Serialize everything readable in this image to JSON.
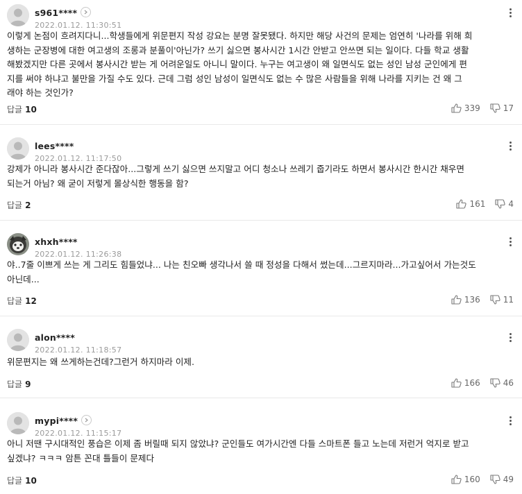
{
  "comments": [
    {
      "username": "s961****",
      "date": "2022.01.12. 11:30:51",
      "lines": [
        "이렇게 논점이 흐려지다니...학생들에게 위문편지 작성 강요는 분명 잘못됐다. 하지만 해당 사건의 문제는 엄연히 '나라를 위해 희",
        "생하는 군장병에 대한 여고생의 조롱과 분풀이'아닌가? 쓰기 싫으면 봉사시간 1시간 안받고 안쓰면 되는 일이다. 다들 학교 생활",
        "해봤겠지만 다른 곳에서 봉사시간 받는 게 어려운일도 아니니 말이다. 누구는 여고생이 왜 일면식도 없는 성인 남성 군인에게 편",
        "지를 써야 하냐고 불만을 가질 수도 있다. 근데 그럼 성인 남성이 일면식도 없는 수 많은 사람들을 위해 나라를 지키는 건 왜 그",
        "래야 하는 것인가?"
      ],
      "reply_label": "답글",
      "reply_count": "10",
      "likes": "339",
      "dislikes": "17"
    },
    {
      "username": "lees****",
      "date": "2022.01.12. 11:17:50",
      "lines": [
        "강제가 아니라 봉사시간 준다잖아...그렇게 쓰기 싫으면 쓰지말고 어디 청소나 쓰레기 줍기라도 하면서 봉사시간 한시간 채우면",
        "되는거 아님? 왜 굳이 저렇게 몰상식한 행동을 함?"
      ],
      "reply_label": "답글",
      "reply_count": "2",
      "likes": "161",
      "dislikes": "4"
    },
    {
      "username": "xhxh****",
      "date": "2022.01.12. 11:26:38",
      "lines": [
        "야..7줄 이쁘게 쓰는 게 그리도 힘들었냐... 나는 친오빠 생각나서 쓸 때 정성을 다해서 썼는데...그르지마라...가고싶어서 가는것도",
        "아닌데..."
      ],
      "reply_label": "답글",
      "reply_count": "12",
      "likes": "136",
      "dislikes": "11"
    },
    {
      "username": "alon****",
      "date": "2022.01.12. 11:18:57",
      "lines": [
        "위문편지는 왜 쓰게하는건데?그런거 하지마라 이제."
      ],
      "reply_label": "답글",
      "reply_count": "9",
      "likes": "166",
      "dislikes": "46"
    },
    {
      "username": "mypi****",
      "date": "2022.01.12. 11:15:17",
      "lines": [
        "아니 저땐 구시대적인 풍습은 이제 좀 버릴때 되지 않았냐? 군인들도 여가시간엔 다들 스마트폰 들고 노는데 저런거 억지로 받고",
        "싶겠냐? ㅋㅋㅋ 암튼 꼰대 틀들이 문제다"
      ],
      "reply_label": "답글",
      "reply_count": "10",
      "likes": "160",
      "dislikes": "49"
    }
  ]
}
